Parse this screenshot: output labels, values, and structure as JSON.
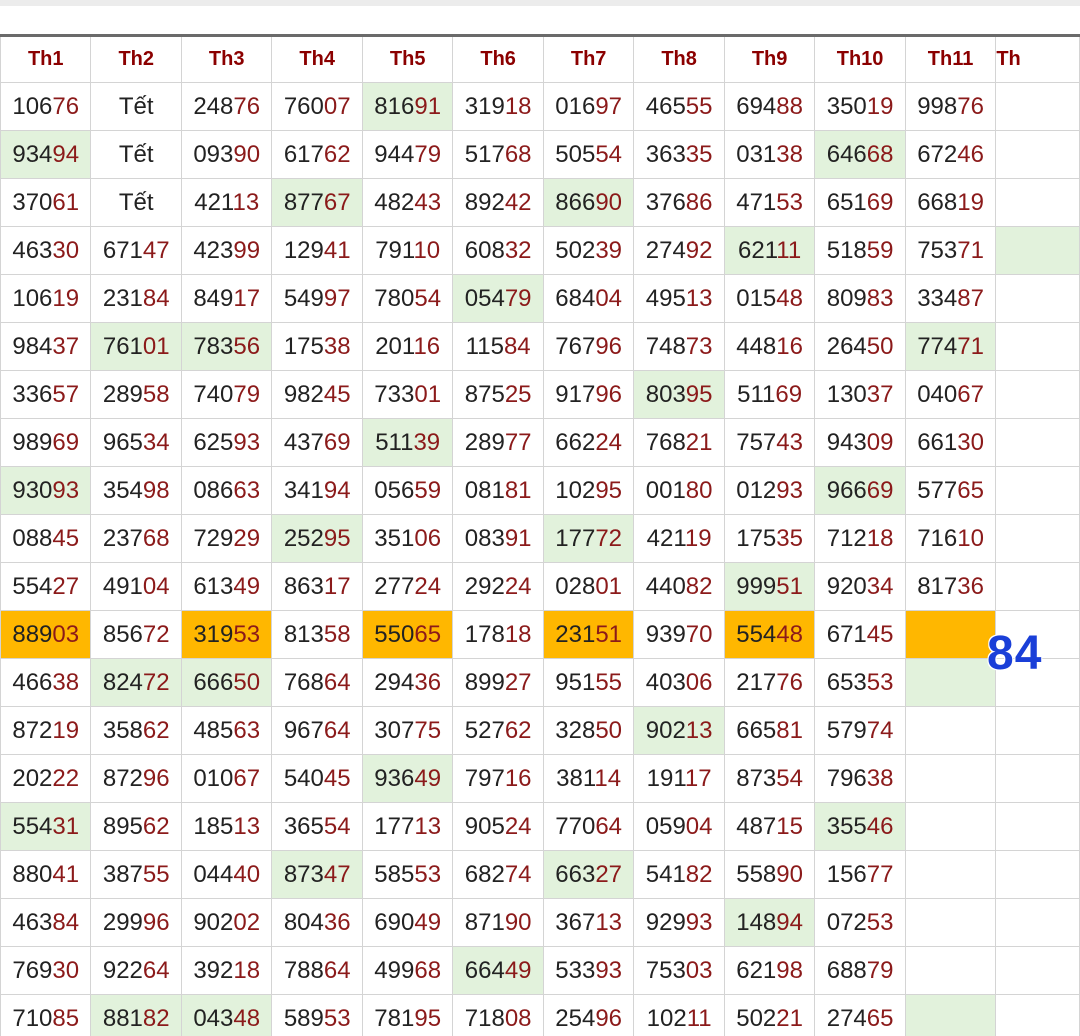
{
  "headers": [
    "Th1",
    "Th2",
    "Th3",
    "Th4",
    "Th5",
    "Th6",
    "Th7",
    "Th8",
    "Th9",
    "Th10",
    "Th11",
    "Th"
  ],
  "special": "84",
  "rows": [
    [
      [
        "10676",
        ""
      ],
      [
        "Tết",
        ""
      ],
      [
        "24876",
        ""
      ],
      [
        "76007",
        ""
      ],
      [
        "81691",
        "g"
      ],
      [
        "31918",
        ""
      ],
      [
        "01697",
        ""
      ],
      [
        "46555",
        ""
      ],
      [
        "69488",
        ""
      ],
      [
        "35019",
        ""
      ],
      [
        "99876",
        ""
      ],
      [
        "",
        ""
      ]
    ],
    [
      [
        "93494",
        "g"
      ],
      [
        "Tết",
        ""
      ],
      [
        "09390",
        ""
      ],
      [
        "61762",
        ""
      ],
      [
        "94479",
        ""
      ],
      [
        "51768",
        ""
      ],
      [
        "50554",
        ""
      ],
      [
        "36335",
        ""
      ],
      [
        "03138",
        ""
      ],
      [
        "64668",
        "g"
      ],
      [
        "67246",
        ""
      ],
      [
        "",
        ""
      ]
    ],
    [
      [
        "37061",
        ""
      ],
      [
        "Tết",
        ""
      ],
      [
        "42113",
        ""
      ],
      [
        "87767",
        "g"
      ],
      [
        "48243",
        ""
      ],
      [
        "89242",
        ""
      ],
      [
        "86690",
        "g"
      ],
      [
        "37686",
        ""
      ],
      [
        "47153",
        ""
      ],
      [
        "65169",
        ""
      ],
      [
        "66819",
        ""
      ],
      [
        "",
        ""
      ]
    ],
    [
      [
        "46330",
        ""
      ],
      [
        "67147",
        ""
      ],
      [
        "42399",
        ""
      ],
      [
        "12941",
        ""
      ],
      [
        "79110",
        ""
      ],
      [
        "60832",
        ""
      ],
      [
        "50239",
        ""
      ],
      [
        "27492",
        ""
      ],
      [
        "62111",
        "g"
      ],
      [
        "51859",
        ""
      ],
      [
        "75371",
        ""
      ],
      [
        "",
        "g"
      ]
    ],
    [
      [
        "10619",
        ""
      ],
      [
        "23184",
        ""
      ],
      [
        "84917",
        ""
      ],
      [
        "54997",
        ""
      ],
      [
        "78054",
        ""
      ],
      [
        "05479",
        "g"
      ],
      [
        "68404",
        ""
      ],
      [
        "49513",
        ""
      ],
      [
        "01548",
        ""
      ],
      [
        "80983",
        ""
      ],
      [
        "33487",
        ""
      ],
      [
        "",
        ""
      ]
    ],
    [
      [
        "98437",
        ""
      ],
      [
        "76101",
        "g"
      ],
      [
        "78356",
        "g"
      ],
      [
        "17538",
        ""
      ],
      [
        "20116",
        ""
      ],
      [
        "11584",
        ""
      ],
      [
        "76796",
        ""
      ],
      [
        "74873",
        ""
      ],
      [
        "44816",
        ""
      ],
      [
        "26450",
        ""
      ],
      [
        "77471",
        "g"
      ],
      [
        "",
        ""
      ]
    ],
    [
      [
        "33657",
        ""
      ],
      [
        "28958",
        ""
      ],
      [
        "74079",
        ""
      ],
      [
        "98245",
        ""
      ],
      [
        "73301",
        ""
      ],
      [
        "87525",
        ""
      ],
      [
        "91796",
        ""
      ],
      [
        "80395",
        "g"
      ],
      [
        "51169",
        ""
      ],
      [
        "13037",
        ""
      ],
      [
        "04067",
        ""
      ],
      [
        "",
        ""
      ]
    ],
    [
      [
        "98969",
        ""
      ],
      [
        "96534",
        ""
      ],
      [
        "62593",
        ""
      ],
      [
        "43769",
        ""
      ],
      [
        "51139",
        "g"
      ],
      [
        "28977",
        ""
      ],
      [
        "66224",
        ""
      ],
      [
        "76821",
        ""
      ],
      [
        "75743",
        ""
      ],
      [
        "94309",
        ""
      ],
      [
        "66130",
        ""
      ],
      [
        "",
        ""
      ]
    ],
    [
      [
        "93093",
        "g"
      ],
      [
        "35498",
        ""
      ],
      [
        "08663",
        ""
      ],
      [
        "34194",
        ""
      ],
      [
        "05659",
        ""
      ],
      [
        "08181",
        ""
      ],
      [
        "10295",
        ""
      ],
      [
        "00180",
        ""
      ],
      [
        "01293",
        ""
      ],
      [
        "96669",
        "g"
      ],
      [
        "57765",
        ""
      ],
      [
        "",
        ""
      ]
    ],
    [
      [
        "08845",
        ""
      ],
      [
        "23768",
        ""
      ],
      [
        "72929",
        ""
      ],
      [
        "25295",
        "g"
      ],
      [
        "35106",
        ""
      ],
      [
        "08391",
        ""
      ],
      [
        "17772",
        "g"
      ],
      [
        "42119",
        ""
      ],
      [
        "17535",
        ""
      ],
      [
        "71218",
        ""
      ],
      [
        "71610",
        ""
      ],
      [
        "",
        ""
      ]
    ],
    [
      [
        "55427",
        ""
      ],
      [
        "49104",
        ""
      ],
      [
        "61349",
        ""
      ],
      [
        "86317",
        ""
      ],
      [
        "27724",
        ""
      ],
      [
        "29224",
        ""
      ],
      [
        "02801",
        ""
      ],
      [
        "44082",
        ""
      ],
      [
        "99951",
        "g"
      ],
      [
        "92034",
        ""
      ],
      [
        "81736",
        ""
      ],
      [
        "",
        ""
      ]
    ],
    [
      [
        "88903",
        "o"
      ],
      [
        "85672",
        ""
      ],
      [
        "31953",
        "o"
      ],
      [
        "81358",
        ""
      ],
      [
        "55065",
        "o"
      ],
      [
        "17818",
        ""
      ],
      [
        "23151",
        "o"
      ],
      [
        "93970",
        ""
      ],
      [
        "55448",
        "o"
      ],
      [
        "67145",
        ""
      ],
      [
        "",
        "o"
      ],
      [
        "",
        ""
      ]
    ],
    [
      [
        "46638",
        ""
      ],
      [
        "82472",
        "g"
      ],
      [
        "66650",
        "g"
      ],
      [
        "76864",
        ""
      ],
      [
        "29436",
        ""
      ],
      [
        "89927",
        ""
      ],
      [
        "95155",
        ""
      ],
      [
        "40306",
        ""
      ],
      [
        "21776",
        ""
      ],
      [
        "65353",
        ""
      ],
      [
        "",
        "g"
      ],
      [
        "",
        ""
      ]
    ],
    [
      [
        "87219",
        ""
      ],
      [
        "35862",
        ""
      ],
      [
        "48563",
        ""
      ],
      [
        "96764",
        ""
      ],
      [
        "30775",
        ""
      ],
      [
        "52762",
        ""
      ],
      [
        "32850",
        ""
      ],
      [
        "90213",
        "g"
      ],
      [
        "66581",
        ""
      ],
      [
        "57974",
        ""
      ],
      [
        "",
        ""
      ],
      [
        "",
        ""
      ]
    ],
    [
      [
        "20222",
        ""
      ],
      [
        "87296",
        ""
      ],
      [
        "01067",
        ""
      ],
      [
        "54045",
        ""
      ],
      [
        "93649",
        "g"
      ],
      [
        "79716",
        ""
      ],
      [
        "38114",
        ""
      ],
      [
        "19117",
        ""
      ],
      [
        "87354",
        ""
      ],
      [
        "79638",
        ""
      ],
      [
        "",
        ""
      ],
      [
        "",
        ""
      ]
    ],
    [
      [
        "55431",
        "g"
      ],
      [
        "89562",
        ""
      ],
      [
        "18513",
        ""
      ],
      [
        "36554",
        ""
      ],
      [
        "17713",
        ""
      ],
      [
        "90524",
        ""
      ],
      [
        "77064",
        ""
      ],
      [
        "05904",
        ""
      ],
      [
        "48715",
        ""
      ],
      [
        "35546",
        "g"
      ],
      [
        "",
        ""
      ],
      [
        "",
        ""
      ]
    ],
    [
      [
        "88041",
        ""
      ],
      [
        "38755",
        ""
      ],
      [
        "04440",
        ""
      ],
      [
        "87347",
        "g"
      ],
      [
        "58553",
        ""
      ],
      [
        "68274",
        ""
      ],
      [
        "66327",
        "g"
      ],
      [
        "54182",
        ""
      ],
      [
        "55890",
        ""
      ],
      [
        "15677",
        ""
      ],
      [
        "",
        ""
      ],
      [
        "",
        ""
      ]
    ],
    [
      [
        "46384",
        ""
      ],
      [
        "29996",
        ""
      ],
      [
        "90202",
        ""
      ],
      [
        "80436",
        ""
      ],
      [
        "69049",
        ""
      ],
      [
        "87190",
        ""
      ],
      [
        "36713",
        ""
      ],
      [
        "92993",
        ""
      ],
      [
        "14894",
        "g"
      ],
      [
        "07253",
        ""
      ],
      [
        "",
        ""
      ],
      [
        "",
        ""
      ]
    ],
    [
      [
        "76930",
        ""
      ],
      [
        "92264",
        ""
      ],
      [
        "39218",
        ""
      ],
      [
        "78864",
        ""
      ],
      [
        "49968",
        ""
      ],
      [
        "66449",
        "g"
      ],
      [
        "53393",
        ""
      ],
      [
        "75303",
        ""
      ],
      [
        "62198",
        ""
      ],
      [
        "68879",
        ""
      ],
      [
        "",
        ""
      ],
      [
        "",
        ""
      ]
    ],
    [
      [
        "71085",
        ""
      ],
      [
        "88182",
        "g"
      ],
      [
        "04348",
        "g"
      ],
      [
        "58953",
        ""
      ],
      [
        "78195",
        ""
      ],
      [
        "71808",
        ""
      ],
      [
        "25496",
        ""
      ],
      [
        "10211",
        ""
      ],
      [
        "50221",
        ""
      ],
      [
        "27465",
        ""
      ],
      [
        "",
        "g"
      ],
      [
        "",
        ""
      ]
    ]
  ]
}
